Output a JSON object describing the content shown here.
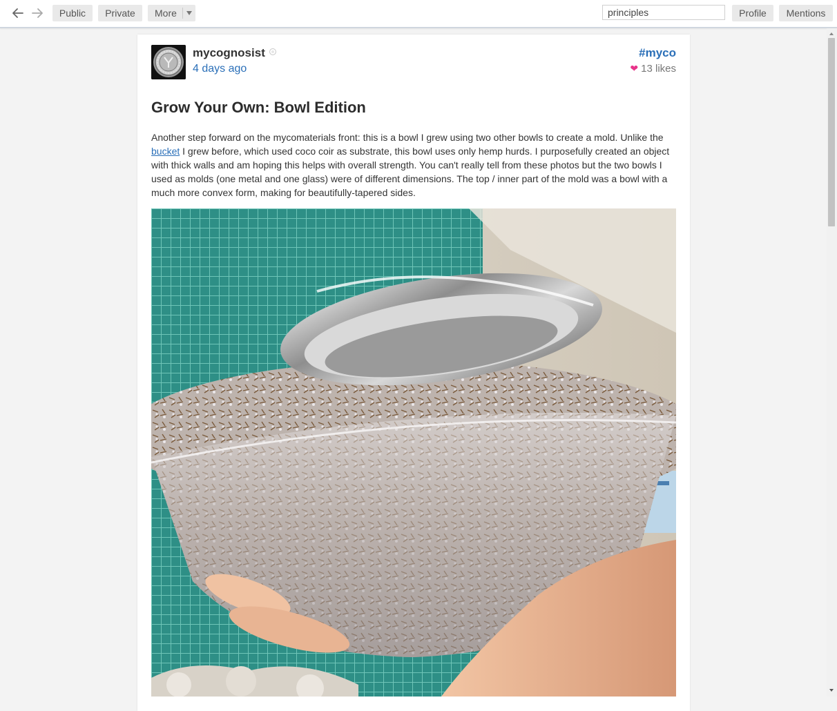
{
  "toolbar": {
    "public_label": "Public",
    "private_label": "Private",
    "more_label": "More",
    "search_value": "principles",
    "profile_label": "Profile",
    "mentions_label": "Mentions"
  },
  "post": {
    "author": "mycognosist",
    "timestamp": "4 days ago",
    "tag": "#myco",
    "likes": "13 likes",
    "title": "Grow Your Own: Bowl Edition",
    "body_before_link": "Another step forward on the mycomaterials front: this is a bowl I grew using two other bowls to create a mold. Unlike the ",
    "link_text": "bucket",
    "body_after_link": " I grew before, which used coco coir as substrate, this bowl uses only hemp hurds. I purposefully created an object with thick walls and am hoping this helps with overall strength. You can't really tell from these photos but the two bowls I used as molds (one metal and one glass) were of different dimensions. The top / inner part of the mold was a bowl with a much more convex form, making for beautifully-tapered sides."
  },
  "colors": {
    "link": "#2a6fb8",
    "heart": "#e8338a",
    "background": "#f3f3f3"
  },
  "icons": {
    "back": "arrow-left",
    "forward": "arrow-right",
    "heart": "heart",
    "online": "circle"
  }
}
